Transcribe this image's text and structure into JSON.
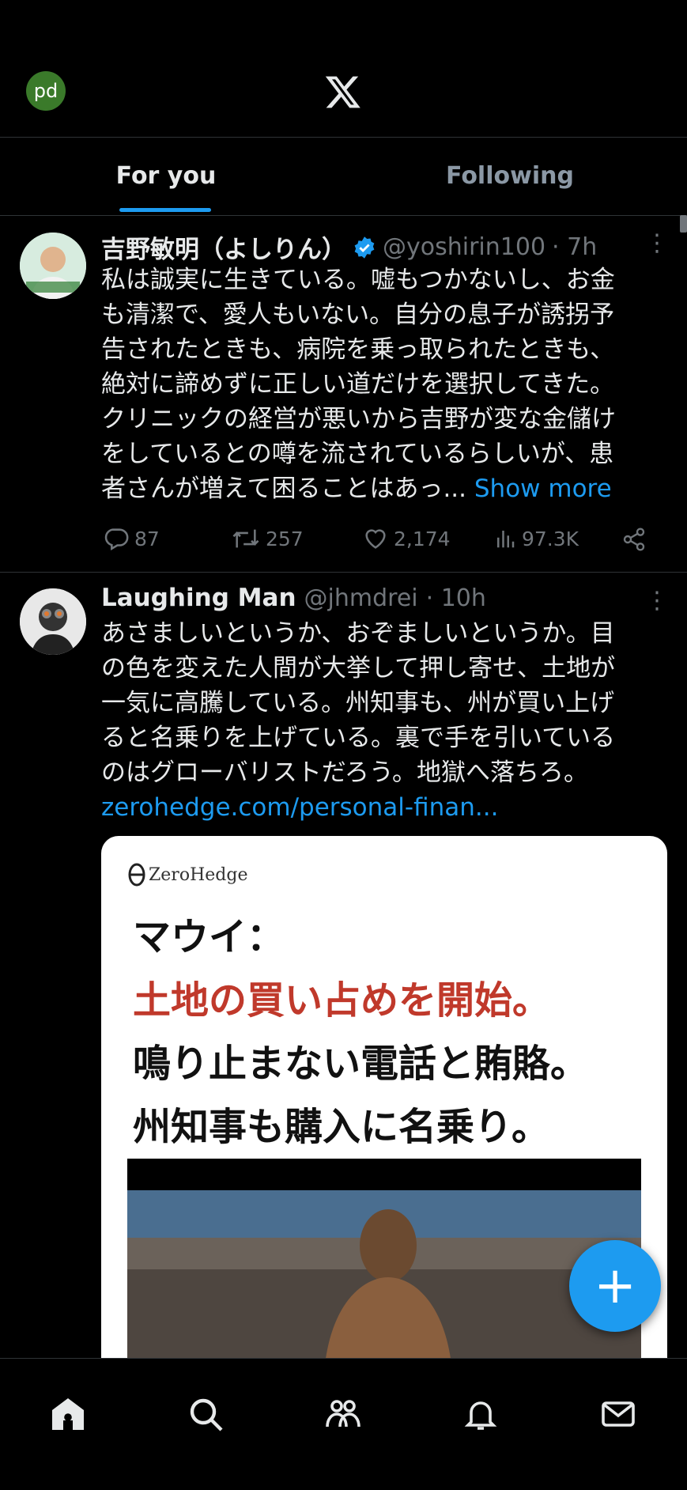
{
  "header": {
    "avatar_initials": "pd",
    "logo": "x-logo-icon"
  },
  "tabs": [
    {
      "label": "For you",
      "active": true
    },
    {
      "label": "Following",
      "active": false
    }
  ],
  "tweets": [
    {
      "name": "吉野敏明（よしりん）",
      "verified": true,
      "handle": "@yoshirin100",
      "time": "· 7h",
      "lines": [
        "私は誠実に生きている。嘘もつかないし、お金",
        "も清潔で、愛人もいない。自分の息子が誘拐予",
        "告されたときも、病院を乗っ取られたときも、",
        "絶対に諦めずに正しい道だけを選択してきた。",
        "クリニックの経営が悪いから吉野が変な金儲け",
        "をしているとの噂を流されているらしいが、患",
        "者さんが増えて困ることはあっ..."
      ],
      "show_more": "Show more",
      "replies": "87",
      "retweets": "257",
      "likes": "2,174",
      "views": "97.3K"
    },
    {
      "name": "Laughing Man",
      "handle": "@jhmdrei",
      "time": "· 10h",
      "lines": [
        "あさましいというか、おぞましいというか。目",
        "の色を変えた人間が大挙して押し寄せ、土地が",
        "一気に高騰している。州知事も、州が買い上げ",
        "ると名乗りを上げている。裏で手を引いている",
        "のはグローバリストだろう。地獄へ落ちろ。"
      ],
      "link": "zerohedge.com/personal-finan...",
      "card": {
        "brand": "ZeroHedge",
        "line1": "マウイ：",
        "line2": "土地の買い占めを開始。",
        "line3": "鳴り止まない電話と賄賂。",
        "line4": "州知事も購入に名乗り。"
      }
    }
  ],
  "fab": {
    "label": "+"
  },
  "bottom_nav": [
    "home-icon",
    "search-icon",
    "communities-icon",
    "notifications-icon",
    "messages-icon"
  ],
  "colors": {
    "accent": "#1d9bf0",
    "background": "#000000",
    "muted": "#71767b",
    "red_headline": "#c0392b"
  }
}
